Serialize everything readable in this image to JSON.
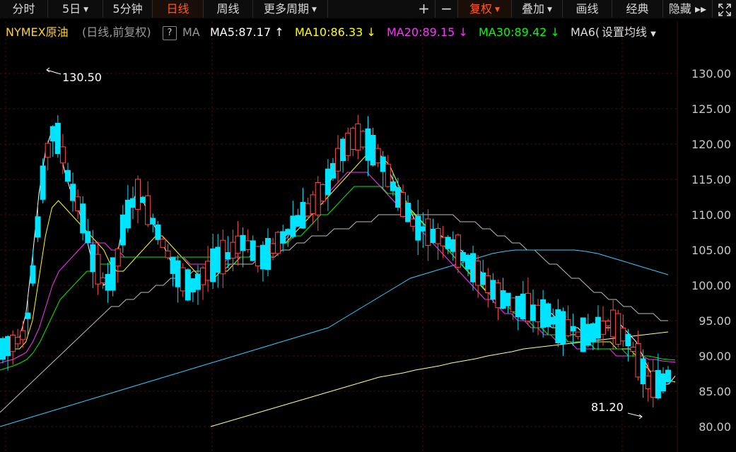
{
  "toolbar": {
    "items": [
      {
        "label": "分时"
      },
      {
        "label": "5日",
        "dropdown": true
      },
      {
        "label": "5分钟"
      },
      {
        "label": "日线",
        "active": true
      },
      {
        "label": "周线"
      },
      {
        "label": "更多周期",
        "dropdown": true
      }
    ],
    "zoom_in": "+",
    "zoom_out": "−",
    "right_items": [
      {
        "label": "复权",
        "dropdown": true,
        "active": true
      },
      {
        "label": "叠加",
        "dropdown": true
      },
      {
        "label": "画线"
      },
      {
        "label": "经典"
      },
      {
        "label": "隐藏 ▸▸"
      }
    ],
    "fullscreen_icon": "expand-icon"
  },
  "legend": {
    "symbol": "NYMEX原油",
    "mode": "(日线,前复权)",
    "help": "?",
    "ma_label": "MA",
    "ma5": {
      "text": "MA5:87.17",
      "arrow": "↑",
      "color": "#ffffff"
    },
    "ma10": {
      "text": "MA10:86.33",
      "arrow": "↓",
      "color": "#ffff00"
    },
    "ma20": {
      "text": "MA20:89.15",
      "arrow": "↓",
      "color": "#ff33ff"
    },
    "ma30": {
      "text": "MA30:89.42",
      "arrow": "↓",
      "color": "#00ff00"
    },
    "ma60": {
      "text": "MA6(",
      "color": "#dddddd"
    },
    "settings": "设置均线"
  },
  "axis": {
    "labels": [
      "130.00",
      "125.00",
      "120.00",
      "115.00",
      "110.00",
      "105.00",
      "100.00",
      "95.00",
      "90.00",
      "85.00",
      "80.00"
    ]
  },
  "annotations": {
    "high": "130.50",
    "low": "81.20"
  },
  "colors": {
    "up": "#ff4a4a",
    "down": "#00e5ff",
    "grid": "#3a0f0f"
  },
  "chart_data": {
    "type": "candlestick",
    "y_range": [
      78,
      134
    ],
    "ma_series": [
      {
        "color": "#ffffff",
        "values": [
          91,
          91.5,
          92,
          92.5,
          96,
          104,
          113,
          119,
          122,
          120,
          116,
          113,
          111,
          108,
          104,
          102,
          100,
          101,
          104,
          109,
          111,
          113,
          112,
          110,
          108,
          106,
          104,
          102,
          101,
          100,
          100,
          101,
          102,
          103,
          104,
          104,
          105,
          106,
          106,
          105,
          104,
          104,
          105,
          106,
          107,
          108,
          109,
          110,
          111,
          112,
          113,
          115,
          117,
          119,
          120,
          121,
          121,
          120,
          119,
          118,
          116,
          114,
          112,
          111,
          109,
          108,
          108,
          107,
          107,
          106,
          106,
          105,
          104,
          103,
          102,
          101,
          100,
          99,
          98,
          98,
          97,
          97,
          97,
          96,
          96,
          96,
          95,
          94,
          94,
          94,
          93,
          93,
          93,
          94,
          94,
          95,
          94,
          93,
          92,
          90,
          88,
          86,
          86,
          86,
          87.17
        ]
      },
      {
        "color": "#ffff00",
        "values": [
          90,
          90.3,
          91,
          91,
          92,
          95,
          101,
          107,
          111,
          112,
          111,
          110,
          109,
          108,
          107,
          106,
          105,
          103,
          102,
          102,
          103,
          104,
          105,
          106,
          107,
          107,
          106,
          105,
          104,
          103,
          102,
          101,
          101,
          101,
          102,
          102,
          103,
          104,
          104,
          104,
          104,
          105,
          105,
          106,
          106,
          107,
          108,
          109,
          110,
          111,
          112,
          113,
          114,
          115,
          116,
          117,
          118,
          119,
          119,
          118,
          117,
          115,
          113,
          111,
          110,
          109,
          108,
          107,
          106,
          105,
          104,
          103,
          102,
          101,
          100,
          99,
          99,
          98,
          98,
          97,
          97,
          96,
          96,
          95,
          95,
          94,
          94,
          93,
          93,
          93,
          93,
          92,
          92,
          92,
          92,
          91,
          91,
          91,
          90,
          89,
          88,
          87,
          87,
          86.5,
          86.33
        ]
      },
      {
        "color": "#ff33ff",
        "values": [
          89,
          89.3,
          89.5,
          90,
          90.5,
          92,
          94,
          97,
          100,
          102,
          103,
          104,
          105,
          106,
          106,
          106,
          106,
          105,
          105,
          104,
          104,
          104,
          104,
          104,
          104,
          104,
          104,
          104,
          104,
          103,
          103,
          103,
          103,
          103,
          103,
          104,
          104,
          104,
          104,
          105,
          105,
          105,
          106,
          106,
          107,
          108,
          109,
          110,
          111,
          112,
          113,
          114,
          115,
          116,
          116,
          116,
          116,
          115,
          114,
          113,
          112,
          111,
          110,
          109,
          108,
          107,
          106,
          105,
          104,
          103,
          102,
          101,
          100,
          99,
          98,
          98,
          97,
          96,
          96,
          95,
          95,
          94,
          94,
          93,
          93,
          92,
          92,
          92,
          91,
          91,
          91,
          91,
          91,
          91,
          90,
          90,
          90,
          90,
          90,
          89.5,
          89.5,
          89.3,
          89.2,
          89.15
        ]
      },
      {
        "color": "#00ee00",
        "values": [
          88,
          88.3,
          88.6,
          89,
          89.5,
          90.5,
          92,
          94,
          96,
          98,
          99,
          100,
          101,
          102,
          102,
          103,
          103,
          103,
          104,
          104,
          104,
          104,
          104,
          104,
          104,
          104,
          104,
          104,
          104,
          104,
          104,
          104,
          104,
          103,
          103,
          103,
          104,
          104,
          104,
          104,
          105,
          105,
          106,
          106,
          107,
          107,
          108,
          109,
          110,
          110,
          111,
          112,
          113,
          114,
          114,
          114,
          114,
          114,
          113,
          113,
          112,
          111,
          110,
          109,
          108,
          107,
          106,
          105,
          104,
          103,
          102,
          101,
          100,
          99,
          98,
          98,
          97,
          96,
          96,
          95,
          94,
          94,
          93,
          93,
          93,
          92,
          92,
          92,
          92,
          91,
          91,
          91,
          91,
          91,
          90,
          90,
          90,
          90,
          89.8,
          89.6,
          89.5,
          89.42
        ]
      },
      {
        "color": "#bbbbbb",
        "values": [
          82,
          83,
          84,
          85,
          86,
          87,
          88,
          89,
          90,
          91,
          92,
          93,
          94,
          95,
          96,
          97,
          97,
          98,
          98,
          99,
          99,
          100,
          100,
          101,
          101,
          101,
          102,
          102,
          102,
          102,
          102,
          103,
          103,
          103,
          103,
          104,
          104,
          104,
          105,
          105,
          106,
          106,
          107,
          107,
          107,
          108,
          108,
          108,
          109,
          109,
          109,
          110,
          110,
          110,
          110,
          110,
          110,
          110,
          110,
          110,
          110,
          110,
          109,
          109,
          109,
          108,
          108,
          107,
          107,
          106,
          106,
          105,
          105,
          104,
          103,
          103,
          102,
          101,
          101,
          100,
          99,
          99,
          98,
          98,
          97,
          97,
          96,
          96,
          96,
          95,
          95
        ]
      },
      {
        "color": "#33ccff",
        "values": [
          80,
          80.5,
          81,
          81.5,
          82,
          82.5,
          83,
          83.5,
          84,
          84.5,
          85,
          85.5,
          86,
          86.5,
          87,
          87.5,
          88,
          88.5,
          89,
          89.5,
          90,
          90.5,
          91,
          91.5,
          92,
          92.5,
          93,
          93.5,
          94,
          95,
          96,
          97,
          98,
          99,
          100,
          101,
          101.5,
          102,
          102.5,
          103,
          103.5,
          104,
          104.5,
          104.8,
          105,
          105,
          105,
          105,
          105,
          105,
          104.8,
          104.5,
          104,
          103.5,
          103,
          102.5,
          102,
          101.5
        ]
      },
      {
        "color": "#ffff99",
        "values": [
          80,
          80.5,
          81,
          81.5,
          82,
          82.5,
          83,
          83.5,
          84,
          84.5,
          85,
          85.5,
          86,
          86.5,
          87,
          87.3,
          87.6,
          88,
          88.3,
          88.6,
          89,
          89.3,
          89.6,
          90,
          90.3,
          90.6,
          91,
          91.2,
          91.4,
          91.6,
          91.8,
          92,
          92.2,
          92.4,
          92.6,
          92.8,
          93,
          93.2,
          93.4
        ]
      }
    ]
  }
}
